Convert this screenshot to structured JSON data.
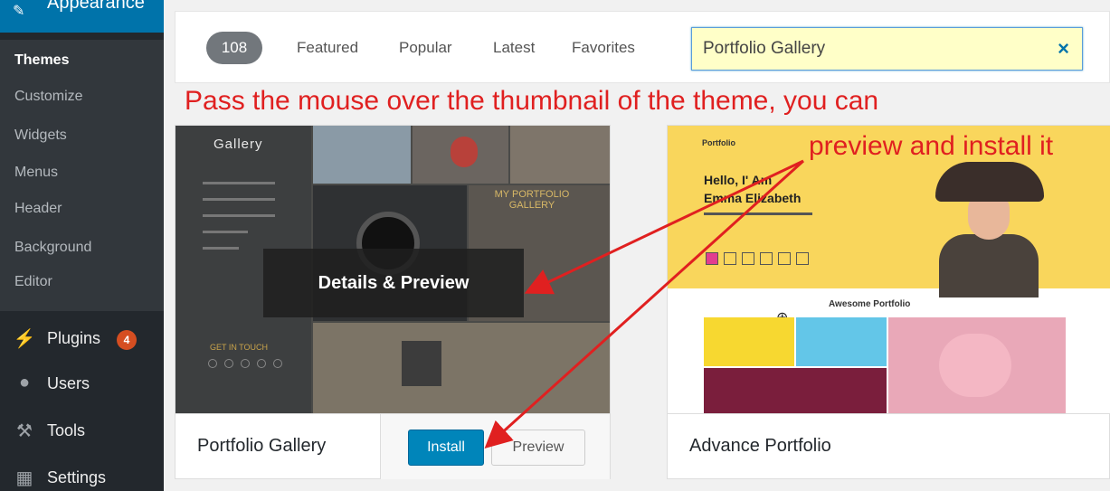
{
  "sidebar": {
    "section_label": "Appearance",
    "submenu": [
      "Themes",
      "Customize",
      "Widgets",
      "Menus",
      "Header",
      "Background",
      "Editor"
    ],
    "menu": [
      {
        "label": "Plugins",
        "icon": "plugin-icon",
        "badge": "4"
      },
      {
        "label": "Users",
        "icon": "users-icon"
      },
      {
        "label": "Tools",
        "icon": "wrench-icon"
      },
      {
        "label": "Settings",
        "icon": "settings-icon"
      }
    ]
  },
  "filterbar": {
    "count": "108",
    "links": [
      "Featured",
      "Popular",
      "Latest",
      "Favorites"
    ],
    "search": {
      "value": "Portfolio Gallery",
      "clear": "×"
    }
  },
  "annotation": {
    "line1": "Pass the mouse over the thumbnail of the theme, you can",
    "line2": "preview and install it",
    "color": "#e02020"
  },
  "themes": [
    {
      "name": "Portfolio Gallery",
      "overlay_label": "Details & Preview",
      "install_label": "Install",
      "preview_label": "Preview",
      "thumb": {
        "logo": "Gallery",
        "heading": "MY PORTFOLIO GALLERY",
        "footer": "GET IN TOUCH"
      }
    },
    {
      "name": "Advance Portfolio",
      "thumb": {
        "brand": "Portfolio",
        "greeting": "Hello, I' Am",
        "person": "Emma Elizabeth",
        "section": "Awesome Portfolio"
      }
    }
  ],
  "colors": {
    "sidebar": "#23282d",
    "accent": "#0073aa",
    "install": "#0085ba",
    "badge": "#d54e21"
  }
}
